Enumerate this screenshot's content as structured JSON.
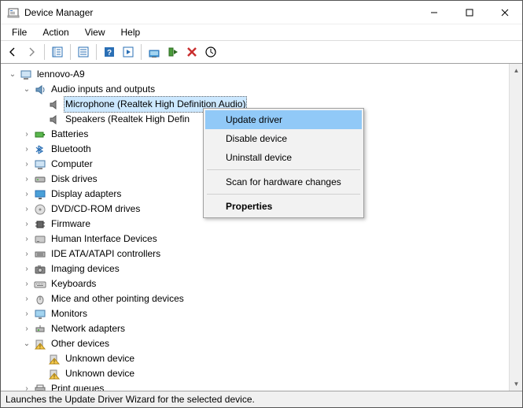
{
  "window": {
    "title": "Device Manager"
  },
  "menubar": {
    "items": [
      "File",
      "Action",
      "View",
      "Help"
    ]
  },
  "tree": {
    "root": "lennovo-A9",
    "audio": {
      "label": "Audio inputs and outputs",
      "mic": "Microphone (Realtek High Definition Audio)",
      "speakers": "Speakers (Realtek High Defin"
    },
    "batteries": "Batteries",
    "bluetooth": "Bluetooth",
    "computer": "Computer",
    "disk": "Disk drives",
    "display": "Display adapters",
    "dvd": "DVD/CD-ROM drives",
    "firmware": "Firmware",
    "hid": "Human Interface Devices",
    "ide": "IDE ATA/ATAPI controllers",
    "imaging": "Imaging devices",
    "keyboards": "Keyboards",
    "mice": "Mice and other pointing devices",
    "monitors": "Monitors",
    "network": "Network adapters",
    "other": {
      "label": "Other devices",
      "unknown1": "Unknown device",
      "unknown2": "Unknown device"
    },
    "printqueues": "Print queues"
  },
  "context": {
    "update": "Update driver",
    "disable": "Disable device",
    "uninstall": "Uninstall device",
    "scan": "Scan for hardware changes",
    "properties": "Properties"
  },
  "status": "Launches the Update Driver Wizard for the selected device."
}
